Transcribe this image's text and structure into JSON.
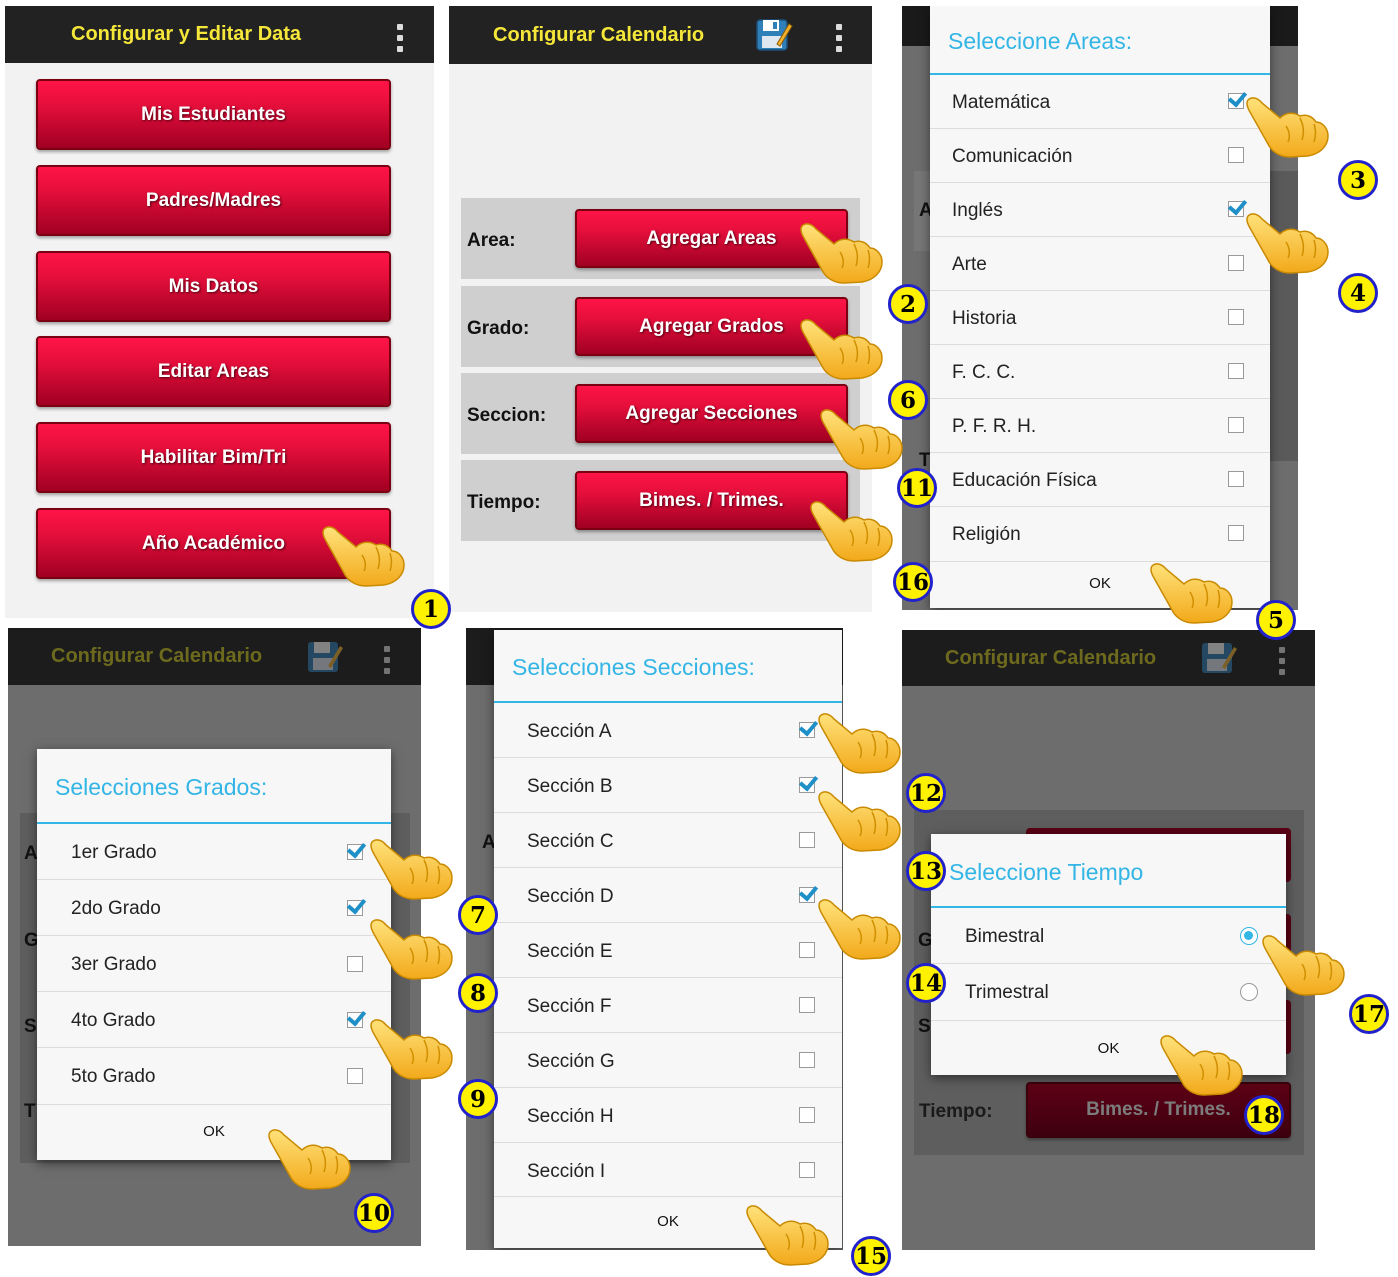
{
  "panel1": {
    "appbar_title": "Configurar y Editar Data",
    "buttons": [
      "Mis Estudiantes",
      "Padres/Madres",
      "Mis Datos",
      "Editar Areas",
      "Habilitar Bim/Tri",
      "Año Académico"
    ]
  },
  "panel2": {
    "appbar_title": "Configurar Calendario",
    "rows": [
      {
        "label": "Area:",
        "button": "Agregar Areas"
      },
      {
        "label": "Grado:",
        "button": "Agregar Grados"
      },
      {
        "label": "Seccion:",
        "button": "Agregar Secciones"
      },
      {
        "label": "Tiempo:",
        "button": "Bimes. / Trimes."
      }
    ]
  },
  "panel3": {
    "dialog_title": "Seleccione Areas:",
    "items": [
      {
        "label": "Matemática",
        "checked": true
      },
      {
        "label": "Comunicación",
        "checked": false
      },
      {
        "label": "Inglés",
        "checked": true
      },
      {
        "label": "Arte",
        "checked": false
      },
      {
        "label": "Historia",
        "checked": false
      },
      {
        "label": "F. C. C.",
        "checked": false
      },
      {
        "label": "P. F. R. H.",
        "checked": false
      },
      {
        "label": "Educación Física",
        "checked": false
      },
      {
        "label": "Religión",
        "checked": false
      }
    ],
    "ok_label": "OK",
    "bg_letters": [
      "A",
      "T"
    ]
  },
  "panel4": {
    "appbar_title": "Configurar Calendario",
    "dialog_title": "Selecciones Grados:",
    "items": [
      {
        "label": "1er Grado",
        "checked": true
      },
      {
        "label": "2do Grado",
        "checked": true
      },
      {
        "label": "3er Grado",
        "checked": false
      },
      {
        "label": "4to Grado",
        "checked": true
      },
      {
        "label": "5to Grado",
        "checked": false
      }
    ],
    "ok_label": "OK",
    "bg_letters": [
      "A",
      "G",
      "S",
      "T"
    ]
  },
  "panel5": {
    "dialog_title": "Selecciones Secciones:",
    "items": [
      {
        "label": "Sección A",
        "checked": true
      },
      {
        "label": "Sección B",
        "checked": true
      },
      {
        "label": "Sección C",
        "checked": false
      },
      {
        "label": "Sección D",
        "checked": true
      },
      {
        "label": "Sección E",
        "checked": false
      },
      {
        "label": "Sección F",
        "checked": false
      },
      {
        "label": "Sección G",
        "checked": false
      },
      {
        "label": "Sección H",
        "checked": false
      },
      {
        "label": "Sección I",
        "checked": false
      }
    ],
    "ok_label": "OK",
    "bg_letters": [
      "A"
    ]
  },
  "panel6": {
    "appbar_title": "Configurar Calendario",
    "dialog_title": "Seleccione Tiempo",
    "options": [
      {
        "label": "Bimestral",
        "selected": true
      },
      {
        "label": "Trimestral",
        "selected": false
      }
    ],
    "ok_label": "OK",
    "bg_row_label": "Tiempo:",
    "bg_button": "Bimes. / Trimes.",
    "bg_letters": [
      "G",
      "S"
    ]
  },
  "steps": [
    "1",
    "2",
    "3",
    "4",
    "5",
    "6",
    "7",
    "8",
    "9",
    "10",
    "11",
    "12",
    "13",
    "14",
    "15",
    "16",
    "17",
    "18"
  ]
}
